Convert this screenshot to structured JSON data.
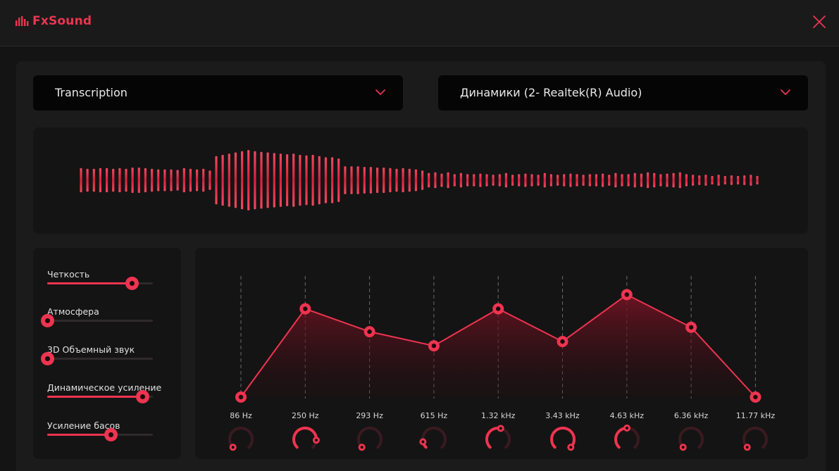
{
  "app": {
    "title": "FxSound",
    "brand_color": "#ee3450"
  },
  "icons": {
    "logo": "equalizer-bars-icon",
    "close": "close-icon",
    "dropdown": "chevron-down-icon"
  },
  "preset_select": {
    "value": "Transcription"
  },
  "output_select": {
    "value": "Динамики (2- Realtek(R) Audio)"
  },
  "effects": [
    {
      "label": "Четкость",
      "value": 0.8
    },
    {
      "label": "Атмосфера",
      "value": 0.0
    },
    {
      "label": "3D Объемный звук",
      "value": 0.0
    },
    {
      "label": "Динамическое усиление",
      "value": 0.9
    },
    {
      "label": "Усиление басов",
      "value": 0.6
    }
  ],
  "equalizer": {
    "bands": [
      {
        "freq": "86 Hz",
        "gain": 0.0,
        "knob": 0.0
      },
      {
        "freq": "250 Hz",
        "gain": 0.81,
        "knob": 0.85
      },
      {
        "freq": "293 Hz",
        "gain": 0.6,
        "knob": 0.0
      },
      {
        "freq": "615 Hz",
        "gain": 0.47,
        "knob": 0.12
      },
      {
        "freq": "1.32 kHz",
        "gain": 0.81,
        "knob": 0.55
      },
      {
        "freq": "3.43 kHz",
        "gain": 0.51,
        "knob": 1.0
      },
      {
        "freq": "4.63 kHz",
        "gain": 0.94,
        "knob": 0.5
      },
      {
        "freq": "6.36 kHz",
        "gain": 0.64,
        "knob": 0.0
      },
      {
        "freq": "11.77 kHz",
        "gain": 0.0,
        "knob": 0.0
      }
    ]
  },
  "visualizer": {
    "bars": [
      0.2,
      0.19,
      0.19,
      0.2,
      0.2,
      0.19,
      0.2,
      0.19,
      0.21,
      0.21,
      0.2,
      0.19,
      0.18,
      0.18,
      0.18,
      0.17,
      0.2,
      0.19,
      0.18,
      0.19,
      0.16,
      0.4,
      0.42,
      0.44,
      0.46,
      0.48,
      0.5,
      0.48,
      0.47,
      0.46,
      0.45,
      0.44,
      0.43,
      0.44,
      0.42,
      0.41,
      0.42,
      0.4,
      0.38,
      0.38,
      0.36,
      0.23,
      0.23,
      0.23,
      0.22,
      0.22,
      0.21,
      0.21,
      0.2,
      0.19,
      0.2,
      0.19,
      0.18,
      0.16,
      0.12,
      0.13,
      0.11,
      0.13,
      0.1,
      0.12,
      0.1,
      0.1,
      0.11,
      0.1,
      0.09,
      0.1,
      0.12,
      0.09,
      0.1,
      0.11,
      0.1,
      0.09,
      0.12,
      0.1,
      0.09,
      0.1,
      0.11,
      0.1,
      0.09,
      0.1,
      0.1,
      0.11,
      0.09,
      0.12,
      0.1,
      0.1,
      0.12,
      0.11,
      0.13,
      0.12,
      0.1,
      0.11,
      0.12,
      0.13,
      0.1,
      0.09,
      0.08,
      0.09,
      0.07,
      0.09,
      0.07,
      0.08,
      0.07,
      0.08,
      0.09,
      0.07
    ]
  }
}
